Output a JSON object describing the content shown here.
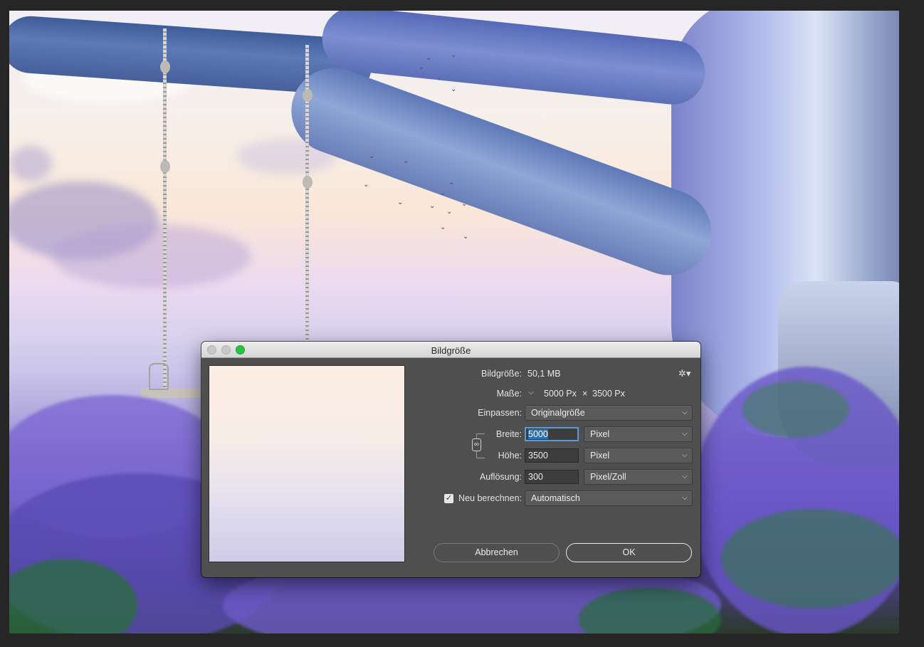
{
  "dialog": {
    "title": "Bildgröße",
    "image_size": {
      "label": "Bildgröße:",
      "value": "50,1 MB"
    },
    "dimensions": {
      "label": "Maße:",
      "width": "5000 Px",
      "times": "×",
      "height": "3500 Px"
    },
    "fit": {
      "label": "Einpassen:",
      "value": "Originalgröße"
    },
    "width": {
      "label": "Breite:",
      "value": "5000",
      "unit": "Pixel"
    },
    "height": {
      "label": "Höhe:",
      "value": "3500",
      "unit": "Pixel"
    },
    "resolution": {
      "label": "Auflösung:",
      "value": "300",
      "unit": "Pixel/Zoll"
    },
    "resample": {
      "label": "Neu berechnen:",
      "checked": true,
      "value": "Automatisch"
    },
    "buttons": {
      "cancel": "Abbrechen",
      "ok": "OK"
    },
    "icons": {
      "settings": "gear-icon",
      "link": "link-icon",
      "dropdown": "chevron-down-icon",
      "check": "checkmark-icon"
    }
  },
  "colors": {
    "dialog_bg": "#4f4f4f",
    "titlebar": "#e0e0e0",
    "zoom_button": "#29c340",
    "focus": "#5b9ad8"
  }
}
